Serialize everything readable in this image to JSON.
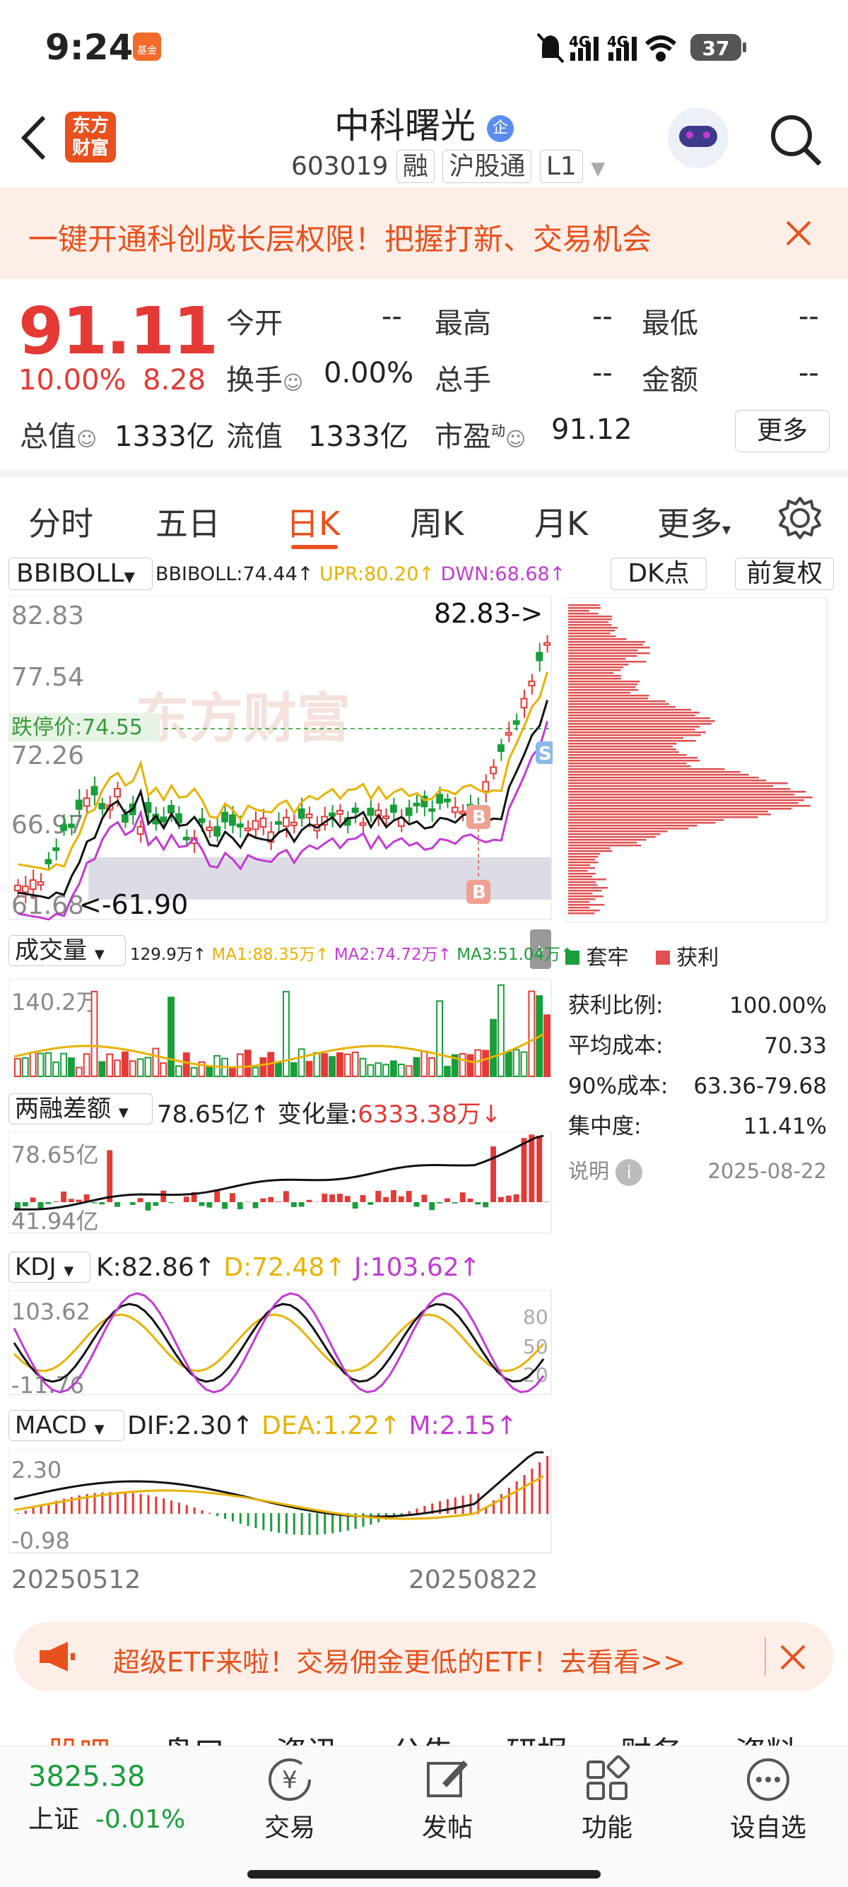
{
  "status_bar": {
    "time": "9:24",
    "notif_badge": "基金",
    "net1": "4G",
    "net2": "4G",
    "battery": "37"
  },
  "header": {
    "logo_line1": "东方",
    "logo_line2": "财富",
    "stock_name": "中科曙光",
    "name_badge": "企",
    "code": "603019",
    "tag1": "融",
    "tag2": "沪股通",
    "tag3": "L1"
  },
  "banner": {
    "text": "一键开通科创成长层权限！把握打新、交易机会"
  },
  "quote": {
    "price": "91.11",
    "change_pct": "10.00%",
    "change": "8.28",
    "open_label": "今开",
    "open_value": "--",
    "high_label": "最高",
    "high_value": "--",
    "low_label": "最低",
    "low_value": "--",
    "turnover_label": "换手",
    "turnover_value": "0.00%",
    "volume_label": "总手",
    "volume_value": "--",
    "amount_label": "金额",
    "amount_value": "--",
    "mktcap_label": "总值",
    "mktcap_value": "1333亿",
    "float_label": "流值",
    "float_value": "1333亿",
    "pe_label": "市盈",
    "pe_sup": "动",
    "pe_value": "91.12",
    "more_button": "更多"
  },
  "tabs": {
    "items": [
      "分时",
      "五日",
      "日K",
      "周K",
      "月K",
      "更多"
    ],
    "active": "日K"
  },
  "kline": {
    "indicator": "BBIBOLL",
    "bbiboll": "BBIBOLL:74.44↑",
    "upr": "UPR:80.20↑",
    "dwn": "DWN:68.68↑",
    "dk_label": "DK点",
    "adjust_label": "前复权",
    "y_labels": [
      "82.83",
      "77.54",
      "72.26",
      "66.97",
      "61.68"
    ],
    "high_marker": "82.83->",
    "low_marker": "<-61.90",
    "limit_down": "跌停价:74.55",
    "watermark": "东方财富",
    "b_marker": "B",
    "s_marker": "S"
  },
  "colors": {
    "up": "#e53935",
    "down": "#1a9d3b",
    "accent": "#e8501d",
    "yellow": "#e8b200",
    "purple": "#c23bd4"
  },
  "chip": {
    "legend_loss": "套牢",
    "legend_profit": "获利",
    "rows": [
      {
        "label": "获利比例:",
        "value": "100.00%"
      },
      {
        "label": "平均成本:",
        "value": "70.33"
      },
      {
        "label": "90%成本:",
        "value": "63.36-79.68"
      },
      {
        "label": "集中度:",
        "value": "11.41%"
      }
    ],
    "note_label": "说明",
    "date": "2025-08-22"
  },
  "volume": {
    "title": "成交量",
    "value": "129.9万↑",
    "ma1": "MA1:88.35万↑",
    "ma2": "MA2:74.72万↑",
    "ma3": "MA3:51.04万↑",
    "y_label": "140.2万"
  },
  "margin": {
    "title": "两融差额",
    "value": "78.65亿↑",
    "change_label": "变化量:",
    "change_value": "6333.38万↓",
    "y_top": "78.65亿",
    "y_bottom": "41.94亿"
  },
  "kdj": {
    "title": "KDJ",
    "k": "K:82.86↑",
    "d": "D:72.48↑",
    "j": "J:103.62↑",
    "y_top": "103.62",
    "y_bottom": "-11.76",
    "ref80": "80",
    "ref50": "50",
    "ref20": "20"
  },
  "macd": {
    "title": "MACD",
    "dif": "DIF:2.30↑",
    "dea": "DEA:1.22↑",
    "m": "M:2.15↑",
    "y_top": "2.30",
    "y_bottom": "-0.98"
  },
  "dates": {
    "start": "20250512",
    "end": "20250822"
  },
  "ad": {
    "text": "超级ETF来啦！交易佣金更低的ETF！去看看>>"
  },
  "subtabs": [
    "股吧",
    "盘口",
    "资讯",
    "公告",
    "研报",
    "财务",
    "资料"
  ],
  "bottom": {
    "index_value": "3825.38",
    "index_name": "上证",
    "index_change": "-0.01%",
    "items": [
      "交易",
      "发帖",
      "功能",
      "设自选"
    ]
  }
}
